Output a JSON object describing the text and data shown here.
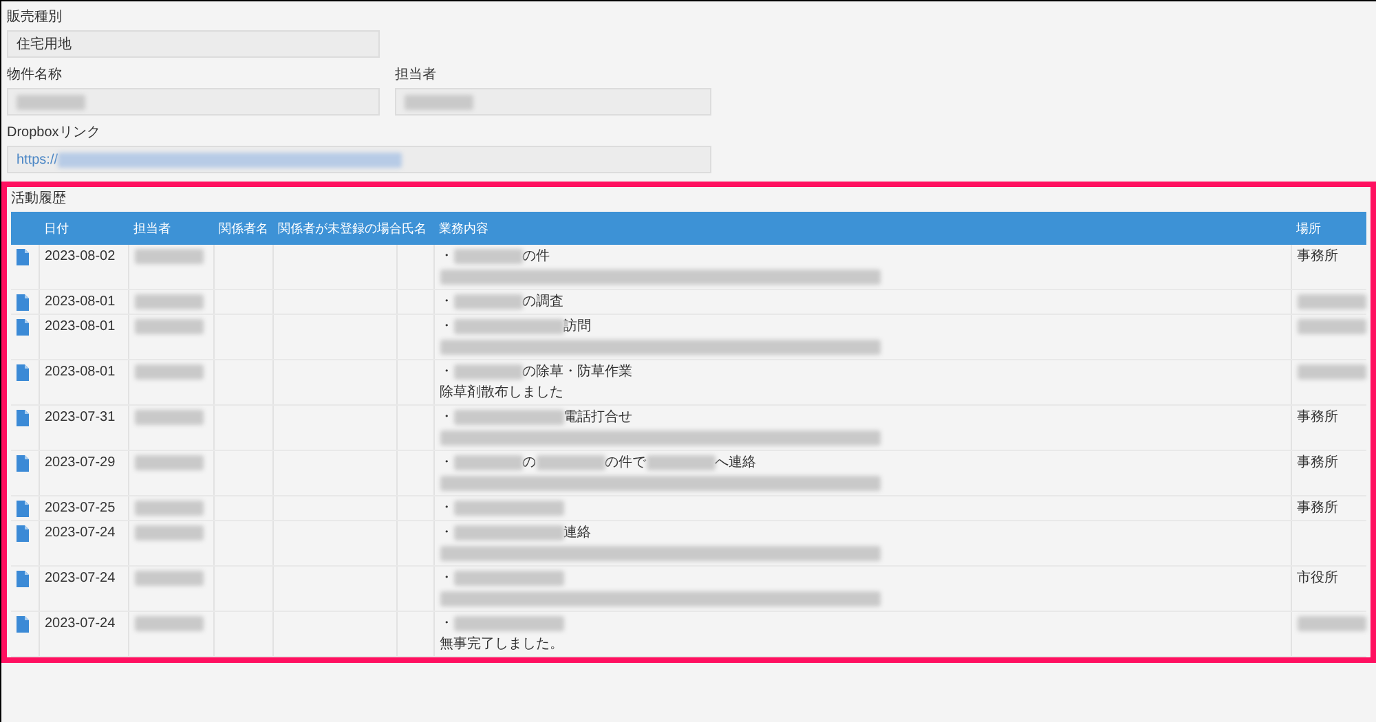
{
  "fields": [
    {
      "label": "販売種別",
      "value": [
        {
          "kind": "text",
          "text": "住宅用地"
        }
      ]
    },
    {
      "label": "物件名称",
      "value": [
        {
          "kind": "redacted"
        }
      ]
    },
    {
      "label": "担当者",
      "value": [
        {
          "kind": "redacted"
        }
      ]
    },
    {
      "label": "Dropboxリンク",
      "value": [
        {
          "kind": "link",
          "text": "https://"
        },
        {
          "kind": "redacted_link"
        }
      ]
    }
  ],
  "activity": {
    "title": "活動履歴",
    "columns": [
      "日付",
      "担当者",
      "関係者名",
      "関係者が未登録の場合",
      "氏名",
      "業務内容",
      "場所"
    ],
    "rows": [
      {
        "date": "2023-08-02",
        "staff": {
          "kind": "redacted"
        },
        "lines": [
          [
            {
              "kind": "text",
              "text": "・"
            },
            {
              "kind": "redacted"
            },
            {
              "kind": "text",
              "text": "の件"
            }
          ],
          [
            {
              "kind": "redacted_long"
            }
          ]
        ],
        "place": {
          "kind": "text",
          "text": "事務所"
        }
      },
      {
        "date": "2023-08-01",
        "staff": {
          "kind": "redacted"
        },
        "lines": [
          [
            {
              "kind": "text",
              "text": "・"
            },
            {
              "kind": "redacted"
            },
            {
              "kind": "text",
              "text": "の調査"
            }
          ]
        ],
        "place": {
          "kind": "redacted"
        }
      },
      {
        "date": "2023-08-01",
        "staff": {
          "kind": "redacted"
        },
        "lines": [
          [
            {
              "kind": "text",
              "text": "・"
            },
            {
              "kind": "redacted_mid"
            },
            {
              "kind": "text",
              "text": "訪問"
            }
          ],
          [
            {
              "kind": "redacted_long"
            }
          ]
        ],
        "place": {
          "kind": "redacted"
        }
      },
      {
        "date": "2023-08-01",
        "staff": {
          "kind": "redacted"
        },
        "lines": [
          [
            {
              "kind": "text",
              "text": "・"
            },
            {
              "kind": "redacted"
            },
            {
              "kind": "text",
              "text": "の除草・防草作業"
            }
          ],
          [
            {
              "kind": "text",
              "text": "除草剤散布しました"
            }
          ]
        ],
        "place": {
          "kind": "redacted"
        }
      },
      {
        "date": "2023-07-31",
        "staff": {
          "kind": "redacted"
        },
        "lines": [
          [
            {
              "kind": "text",
              "text": "・"
            },
            {
              "kind": "redacted_mid"
            },
            {
              "kind": "text",
              "text": "電話打合せ"
            }
          ],
          [
            {
              "kind": "redacted_long"
            }
          ]
        ],
        "place": {
          "kind": "text",
          "text": "事務所"
        }
      },
      {
        "date": "2023-07-29",
        "staff": {
          "kind": "redacted"
        },
        "lines": [
          [
            {
              "kind": "text",
              "text": "・"
            },
            {
              "kind": "redacted"
            },
            {
              "kind": "text",
              "text": "の"
            },
            {
              "kind": "redacted"
            },
            {
              "kind": "text",
              "text": "の件で"
            },
            {
              "kind": "redacted"
            },
            {
              "kind": "text",
              "text": "へ連絡"
            }
          ],
          [
            {
              "kind": "redacted_long"
            }
          ]
        ],
        "place": {
          "kind": "text",
          "text": "事務所"
        }
      },
      {
        "date": "2023-07-25",
        "staff": {
          "kind": "redacted"
        },
        "lines": [
          [
            {
              "kind": "text",
              "text": "・"
            },
            {
              "kind": "redacted_mid"
            }
          ]
        ],
        "place": {
          "kind": "text",
          "text": "事務所"
        }
      },
      {
        "date": "2023-07-24",
        "staff": {
          "kind": "redacted"
        },
        "lines": [
          [
            {
              "kind": "text",
              "text": "・"
            },
            {
              "kind": "redacted_mid"
            },
            {
              "kind": "text",
              "text": "連絡"
            }
          ],
          [
            {
              "kind": "redacted_long"
            }
          ]
        ]
      },
      {
        "date": "2023-07-24",
        "staff": {
          "kind": "redacted"
        },
        "lines": [
          [
            {
              "kind": "text",
              "text": "・"
            },
            {
              "kind": "redacted_mid"
            }
          ],
          [
            {
              "kind": "redacted_long"
            }
          ]
        ],
        "place": {
          "kind": "text",
          "text": "市役所"
        }
      },
      {
        "date": "2023-07-24",
        "staff": {
          "kind": "redacted"
        },
        "lines": [
          [
            {
              "kind": "text",
              "text": "・"
            },
            {
              "kind": "redacted_mid"
            }
          ],
          [
            {
              "kind": "text",
              "text": "無事完了しました。"
            }
          ]
        ],
        "place": {
          "kind": "redacted"
        }
      }
    ]
  }
}
